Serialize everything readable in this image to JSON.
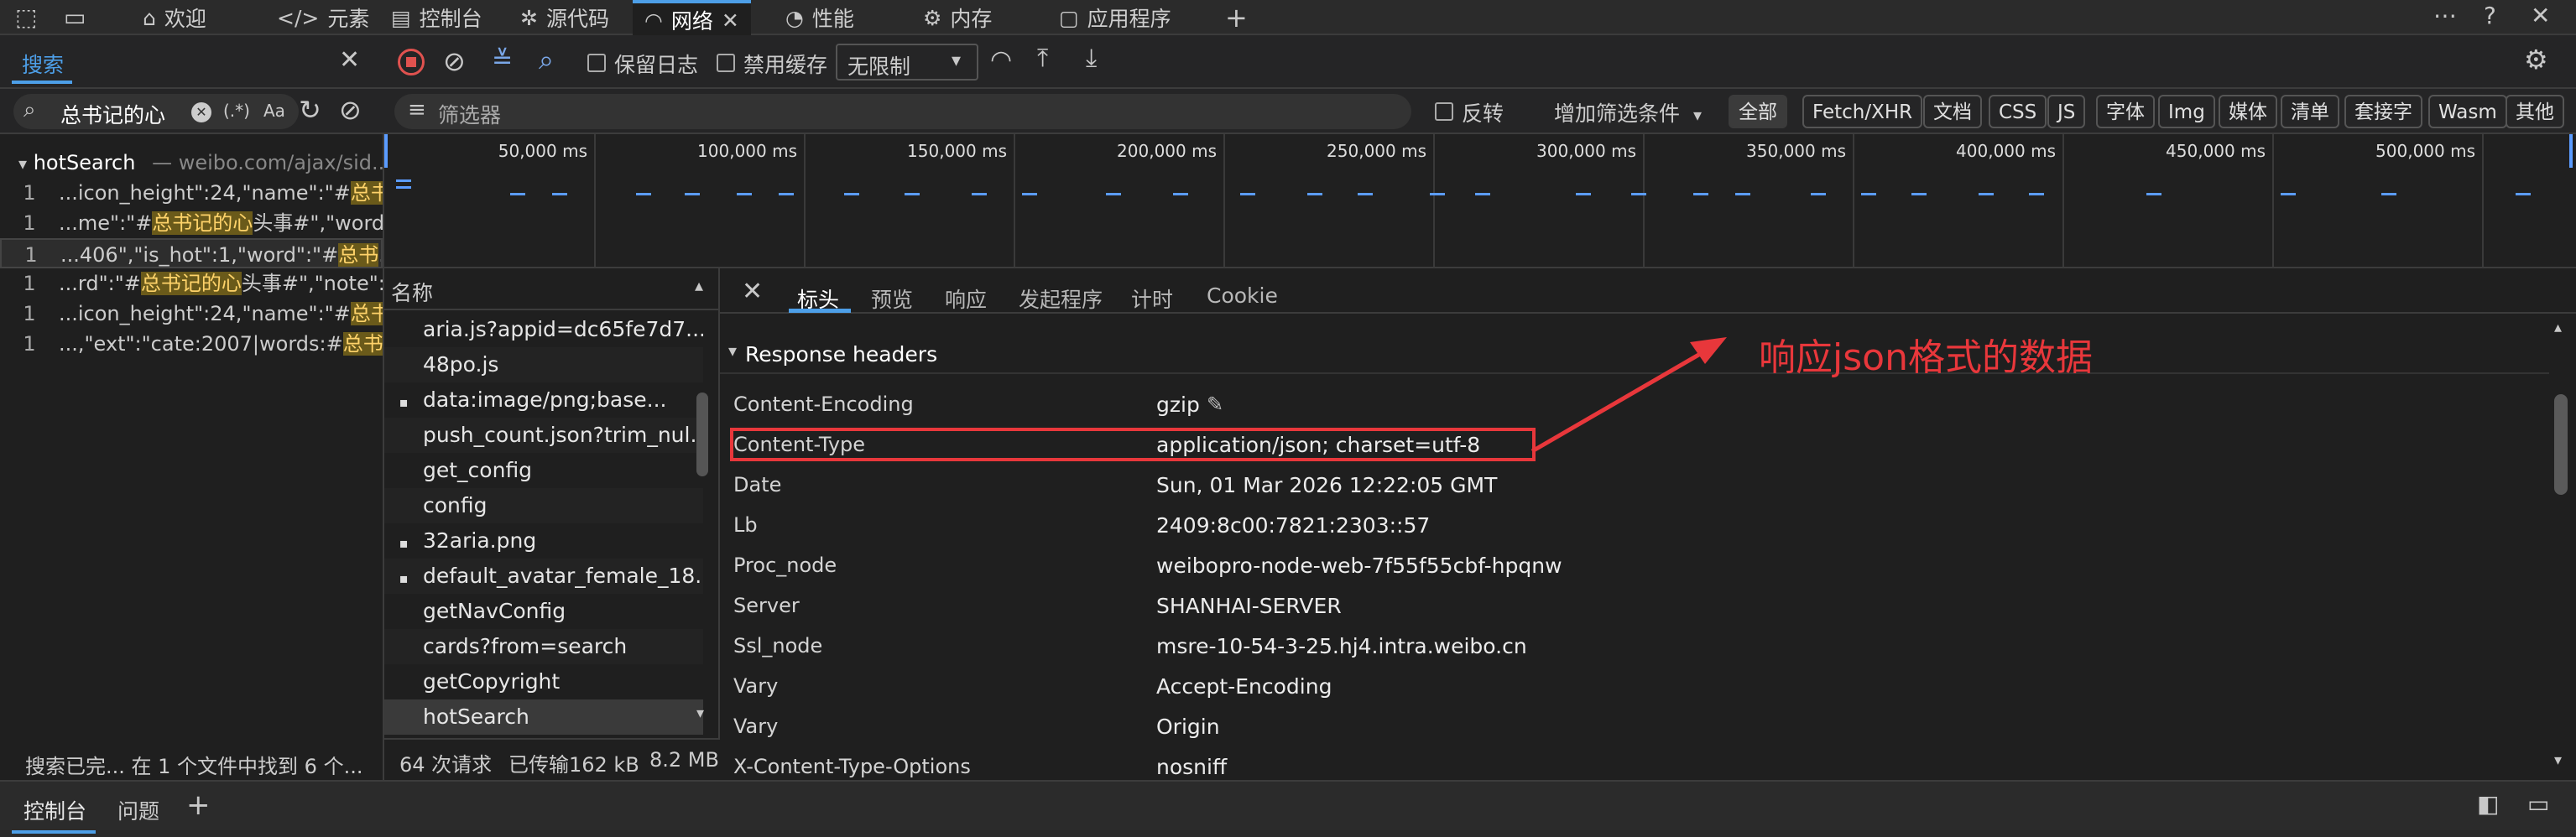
{
  "toolbar": {
    "tabs": [
      {
        "label": "欢迎"
      },
      {
        "label": "元素"
      },
      {
        "label": "控制台"
      },
      {
        "label": "源代码"
      },
      {
        "label": "网络"
      },
      {
        "label": "性能"
      },
      {
        "label": "内存"
      },
      {
        "label": "应用程序"
      }
    ]
  },
  "search_panel": {
    "tab_label": "搜索",
    "query": "总书记的心",
    "regex_label": "(.*)",
    "case_label": "Aa",
    "result_file": "hotSearch",
    "result_url": "— weibo.com/ajax/sid...",
    "results": [
      {
        "line": "1",
        "pre": "...icon_height\":24,\"name\":\"#",
        "hit": "总书",
        "post": ""
      },
      {
        "line": "1",
        "pre": "...me\":\"#",
        "hit": "总书记的心",
        "post": "头事#\",\"word..."
      },
      {
        "line": "1",
        "pre": "...406\",\"is_hot\":1,\"word\":\"#",
        "hit": "总书",
        "post": "..."
      },
      {
        "line": "1",
        "pre": "...rd\":\"#",
        "hit": "总书记的心",
        "post": "头事#\",\"note\":..."
      },
      {
        "line": "1",
        "pre": "...icon_height\":24,\"name\":\"#",
        "hit": "总书",
        "post": ""
      },
      {
        "line": "1",
        "pre": "...,\"ext\":\"cate:2007|words:#",
        "hit": "总书",
        "post": "..."
      }
    ],
    "status": "搜索已完...   在 1 个文件中找到 6 个..."
  },
  "network_toolbar": {
    "preserve_log": "保留日志",
    "disable_cache": "禁用缓存",
    "throttle": "无限制"
  },
  "filter_bar": {
    "placeholder": "筛选器",
    "invert": "反转",
    "more_filters": "增加筛选条件",
    "types": [
      "全部",
      "Fetch/XHR",
      "文档",
      "CSS",
      "JS",
      "字体",
      "Img",
      "媒体",
      "清单",
      "套接字",
      "Wasm",
      "其他"
    ]
  },
  "timeline": {
    "ticks": [
      "50,000 ms",
      "100,000 ms",
      "150,000 ms",
      "200,000 ms",
      "250,000 ms",
      "300,000 ms",
      "350,000 ms",
      "400,000 ms",
      "450,000 ms",
      "500,000 ms"
    ]
  },
  "request_list": {
    "header": "名称",
    "items": [
      {
        "name": "aria.js?appid=dc65fe7d7...",
        "icon": ""
      },
      {
        "name": "48po.js",
        "icon": ""
      },
      {
        "name": "data:image/png;base...",
        "icon": "image-icon"
      },
      {
        "name": "push_count.json?trim_nul...",
        "icon": ""
      },
      {
        "name": "get_config",
        "icon": ""
      },
      {
        "name": "config",
        "icon": ""
      },
      {
        "name": "32aria.png",
        "icon": "image-icon"
      },
      {
        "name": "default_avatar_female_18...",
        "icon": "image-icon"
      },
      {
        "name": "getNavConfig",
        "icon": ""
      },
      {
        "name": "cards?from=search",
        "icon": ""
      },
      {
        "name": "getCopyright",
        "icon": ""
      },
      {
        "name": "hotSearch",
        "icon": ""
      }
    ],
    "summary_requests": "64 次请求",
    "summary_transferred": "已传输162 kB",
    "summary_size": "8.2 MB"
  },
  "details": {
    "tabs": [
      "标头",
      "预览",
      "响应",
      "发起程序",
      "计时",
      "Cookie"
    ],
    "section_title": "Response headers",
    "headers": [
      {
        "name": "Content-Encoding",
        "value": "gzip"
      },
      {
        "name": "Content-Type",
        "value": "application/json; charset=utf-8"
      },
      {
        "name": "Date",
        "value": "Sun, 01 Mar 2026 12:22:05 GMT"
      },
      {
        "name": "Lb",
        "value": "2409:8c00:7821:2303::57"
      },
      {
        "name": "Proc_node",
        "value": "weibopro-node-web-7f55f55cbf-hpqnw"
      },
      {
        "name": "Server",
        "value": "SHANHAI-SERVER"
      },
      {
        "name": "Ssl_node",
        "value": "msre-10-54-3-25.hj4.intra.weibo.cn"
      },
      {
        "name": "Vary",
        "value": "Accept-Encoding"
      },
      {
        "name": "Vary",
        "value": "Origin"
      },
      {
        "name": "X-Content-Type-Options",
        "value": "nosniff"
      }
    ],
    "annotation": "响应json格式的数据",
    "annotation_color": "#e8373b"
  },
  "drawer": {
    "tabs": [
      "控制台",
      "问题"
    ]
  },
  "colors": {
    "accent": "#4d9fe8",
    "record_stop": "#e0524f",
    "highlight": "#ffd36a"
  }
}
